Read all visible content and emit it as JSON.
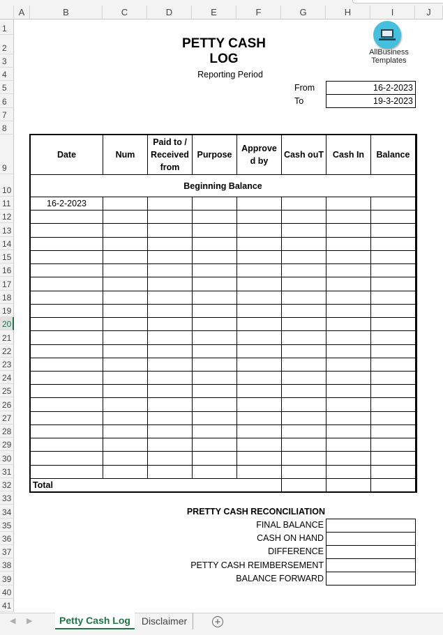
{
  "columns": [
    "A",
    "B",
    "C",
    "D",
    "E",
    "F",
    "G",
    "H",
    "I",
    "J"
  ],
  "rows": [
    "1",
    "2",
    "3",
    "4",
    "5",
    "6",
    "7",
    "8",
    "9",
    "10",
    "11",
    "12",
    "13",
    "14",
    "15",
    "16",
    "17",
    "18",
    "19",
    "20",
    "21",
    "22",
    "23",
    "24",
    "25",
    "26",
    "27",
    "28",
    "29",
    "30",
    "31",
    "32",
    "33",
    "34",
    "35",
    "36",
    "37",
    "38",
    "39",
    "40",
    "41"
  ],
  "selected_row": "20",
  "title": "PETTY CASH LOG",
  "logo": {
    "line1": "AllBusiness",
    "line2": "Templates",
    "color": "#45c0dc"
  },
  "reporting_period": {
    "label": "Reporting Period",
    "from_label": "From",
    "from_value": "16-2-2023",
    "to_label": "To",
    "to_value": "19-3-2023"
  },
  "table": {
    "headers": [
      "Date",
      "Num",
      "Paid to / Received from",
      "Purpose",
      "Approve d by",
      "Cash ouT",
      "Cash In",
      "Balance"
    ],
    "beginning_balance": "Beginning Balance",
    "rows": [
      [
        "16-2-2023",
        "",
        "",
        "",
        "",
        "",
        "",
        ""
      ],
      [
        "",
        "",
        "",
        "",
        "",
        "",
        "",
        ""
      ],
      [
        "",
        "",
        "",
        "",
        "",
        "",
        "",
        ""
      ],
      [
        "",
        "",
        "",
        "",
        "",
        "",
        "",
        ""
      ],
      [
        "",
        "",
        "",
        "",
        "",
        "",
        "",
        ""
      ],
      [
        "",
        "",
        "",
        "",
        "",
        "",
        "",
        ""
      ],
      [
        "",
        "",
        "",
        "",
        "",
        "",
        "",
        ""
      ],
      [
        "",
        "",
        "",
        "",
        "",
        "",
        "",
        ""
      ],
      [
        "",
        "",
        "",
        "",
        "",
        "",
        "",
        ""
      ],
      [
        "",
        "",
        "",
        "",
        "",
        "",
        "",
        ""
      ],
      [
        "",
        "",
        "",
        "",
        "",
        "",
        "",
        ""
      ],
      [
        "",
        "",
        "",
        "",
        "",
        "",
        "",
        ""
      ],
      [
        "",
        "",
        "",
        "",
        "",
        "",
        "",
        ""
      ],
      [
        "",
        "",
        "",
        "",
        "",
        "",
        "",
        ""
      ],
      [
        "",
        "",
        "",
        "",
        "",
        "",
        "",
        ""
      ],
      [
        "",
        "",
        "",
        "",
        "",
        "",
        "",
        ""
      ],
      [
        "",
        "",
        "",
        "",
        "",
        "",
        "",
        ""
      ],
      [
        "",
        "",
        "",
        "",
        "",
        "",
        "",
        ""
      ],
      [
        "",
        "",
        "",
        "",
        "",
        "",
        "",
        ""
      ],
      [
        "",
        "",
        "",
        "",
        "",
        "",
        "",
        ""
      ],
      [
        "",
        "",
        "",
        "",
        "",
        "",
        "",
        ""
      ]
    ],
    "total_label": "Total"
  },
  "reconciliation": {
    "title": "PRETTY CASH RECONCILIATION",
    "items": [
      {
        "label": "FINAL BALANCE",
        "value": ""
      },
      {
        "label": "CASH ON HAND",
        "value": ""
      },
      {
        "label": "DIFFERENCE",
        "value": ""
      },
      {
        "label": "PETTY CASH REIMBERSEMENT",
        "value": ""
      },
      {
        "label": "BALANCE FORWARD",
        "value": ""
      }
    ]
  },
  "sheet_tabs": [
    {
      "label": "Petty Cash Log",
      "active": true
    },
    {
      "label": "Disclaimer",
      "active": false
    }
  ],
  "accent_color": "#217346"
}
